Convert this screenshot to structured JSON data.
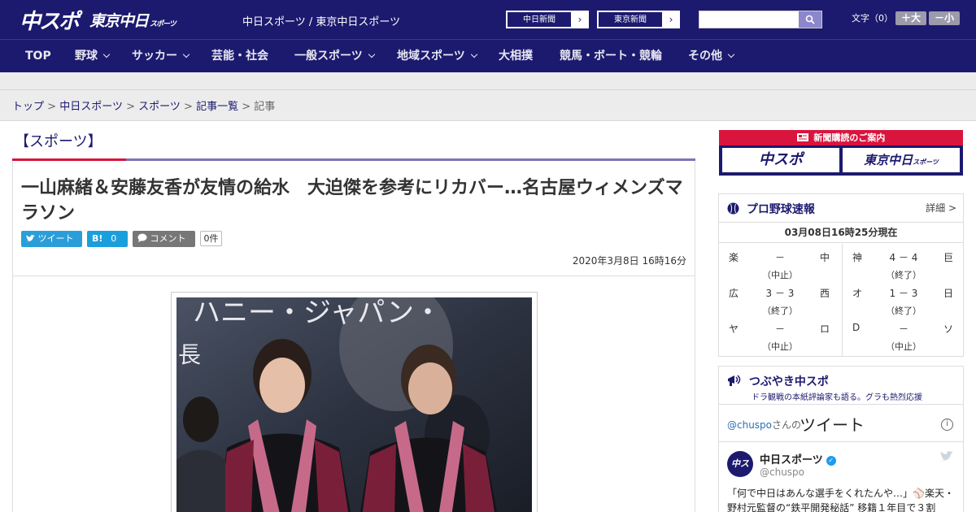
{
  "header": {
    "logo_main": "中スポ",
    "logo_sub": "東京中日",
    "logo_sub_small": "スポーツ",
    "site_names": "中日スポーツ / 東京中日スポーツ",
    "paper_links": [
      {
        "label": "中日新聞"
      },
      {
        "label": "東京新聞"
      }
    ],
    "search_placeholder": "",
    "font_size_label": "文字（0）",
    "font_plus": "＋大",
    "font_minus": "－小"
  },
  "nav": {
    "items": [
      {
        "label": "TOP"
      },
      {
        "label": "野球"
      },
      {
        "label": "サッカー"
      },
      {
        "label": "芸能・社会"
      },
      {
        "label": "一般スポーツ"
      },
      {
        "label": "地域スポーツ"
      },
      {
        "label": "大相撲"
      },
      {
        "label": "競馬・ボート・競輪"
      },
      {
        "label": "その他"
      }
    ]
  },
  "breadcrumb": {
    "items": [
      "トップ",
      "中日スポーツ",
      "スポーツ",
      "記事一覧"
    ],
    "current": "記事",
    "sep": ">"
  },
  "article": {
    "section": "【スポーツ】",
    "headline": "一山麻緒＆安藤友香が友情の給水　大迫傑を参考にリカバー…名古屋ウィメンズマラソン",
    "tweet_label": "ツイート",
    "hatena_label": "B!",
    "hatena_count": "0",
    "comment_label": "コメント",
    "comment_count": "0件",
    "date": "2020年3月8日 16時16分"
  },
  "sidebar": {
    "subscribe_head": "新聞購読のご案内",
    "subscribe_logos": [
      "中スポ",
      "東京中日"
    ],
    "subscribe_logo_small": "スポーツ",
    "baseball": {
      "title": "プロ野球速報",
      "detail": "詳細 >",
      "time": "03月08日16時25分現在",
      "left_games": [
        {
          "home": "楽",
          "score": "－",
          "away": "中",
          "status": "（中止）"
        },
        {
          "home": "広",
          "score": "3 － 3",
          "away": "西",
          "status": "（終了）"
        },
        {
          "home": "ヤ",
          "score": "－",
          "away": "ロ",
          "status": "（中止）"
        }
      ],
      "right_games": [
        {
          "home": "神",
          "score": "4 － 4",
          "away": "巨",
          "status": "（終了）"
        },
        {
          "home": "オ",
          "score": "1 － 3",
          "away": "日",
          "status": "（終了）"
        },
        {
          "home": "D",
          "score": "－",
          "away": "ソ",
          "status": "（中止）"
        }
      ]
    },
    "tsubuyaki": {
      "title": "つぶやき中スポ",
      "subtitle": "ドラ観戦の本紙評論家も語る。グラも熱烈応援",
      "handle": "@chuspo",
      "handle_suffix": "さんの",
      "word": "ツイート",
      "avatar_text": "中スポ",
      "name": "中日スポーツ",
      "user": "@chuspo",
      "text": "「何で中日はあんな選手をくれたんや…」⚾楽天・野村元監督の“鉄平開発秘話” 移籍１年目で３割"
    }
  }
}
